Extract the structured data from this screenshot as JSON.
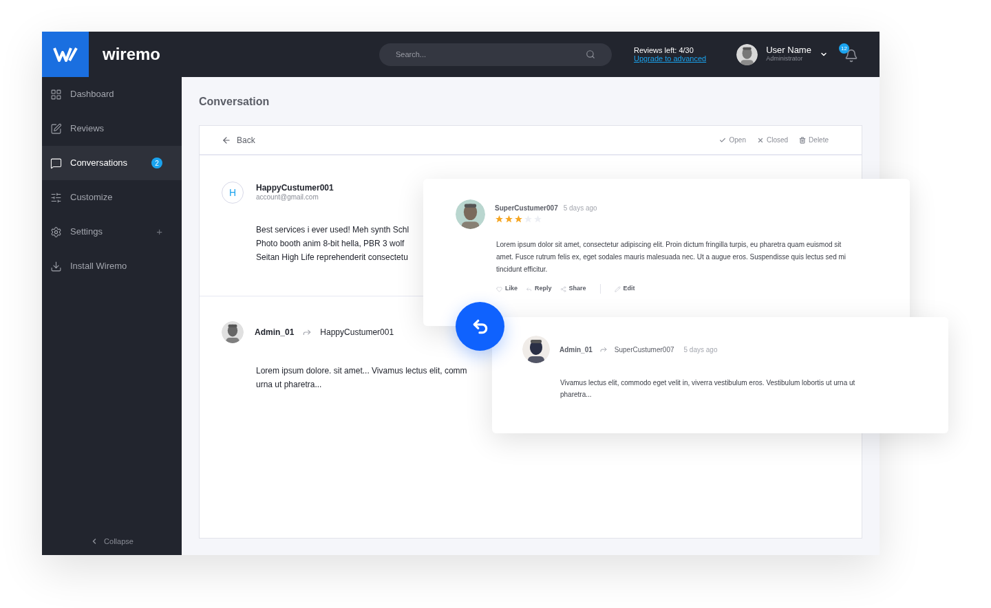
{
  "header": {
    "logo_text": "wiremo",
    "search": {
      "placeholder": "Search..."
    },
    "reviews_left": "Reviews left: 4/30",
    "upgrade_link": "Upgrade to advanced",
    "user": {
      "name": "User Name",
      "role": "Administrator"
    },
    "notifications": "12"
  },
  "sidebar": {
    "items": [
      {
        "label": "Dashboard",
        "selected": false
      },
      {
        "label": "Reviews",
        "selected": false
      },
      {
        "label": "Conversations",
        "selected": true,
        "badge": "2"
      },
      {
        "label": "Customize",
        "selected": false
      },
      {
        "label": "Settings",
        "selected": false,
        "expand": "+"
      },
      {
        "label": "Install Wiremo",
        "selected": false
      }
    ],
    "collapse": "Collapse"
  },
  "page_title": "Conversation",
  "toolbar": {
    "back": "Back",
    "actions": [
      {
        "label": "Open"
      },
      {
        "label": "Closed"
      },
      {
        "label": "Delete"
      }
    ]
  },
  "messages": [
    {
      "kind": "letter",
      "avatar_letter": "H",
      "name": "HappyCustumer001",
      "email": "account@gmail.com",
      "lines": [
        "Best services i ever used! Meh synth Schl",
        "Photo booth anim 8-bit hella, PBR 3 wolf",
        "Seitan High Life reprehenderit consectetu"
      ]
    },
    {
      "kind": "reply",
      "author": "Admin_01",
      "recipient": "HappyCustumer001",
      "lines": [
        "Lorem ipsum dolore. sit amet... Vivamus lectus elit, comm",
        "urna ut pharetra..."
      ]
    }
  ],
  "review_card": {
    "author": "SuperCustumer007",
    "time": "5 days ago",
    "stars": 3,
    "text": "Lorem ipsum dolor sit amet, consectetur adipiscing elit. Proin dictum fringilla turpis, eu pharetra quam euismod sit amet. Fusce rutrum felis ex, eget sodales mauris malesuada nec. Ut a augue eros. Suspendisse quis lectus sed mi tincidunt efficitur.",
    "actions": [
      {
        "label": "Like"
      },
      {
        "label": "Reply"
      },
      {
        "label": "Share"
      },
      {
        "label": "Edit"
      }
    ]
  },
  "reply_card": {
    "author": "Admin_01",
    "recipient": "SuperCustumer007",
    "time": "5 days ago",
    "text": "Vivamus lectus elit, commodo eget velit in, viverra vestibulum eros. Vestibulum lobortis ut urna ut pharetra..."
  }
}
